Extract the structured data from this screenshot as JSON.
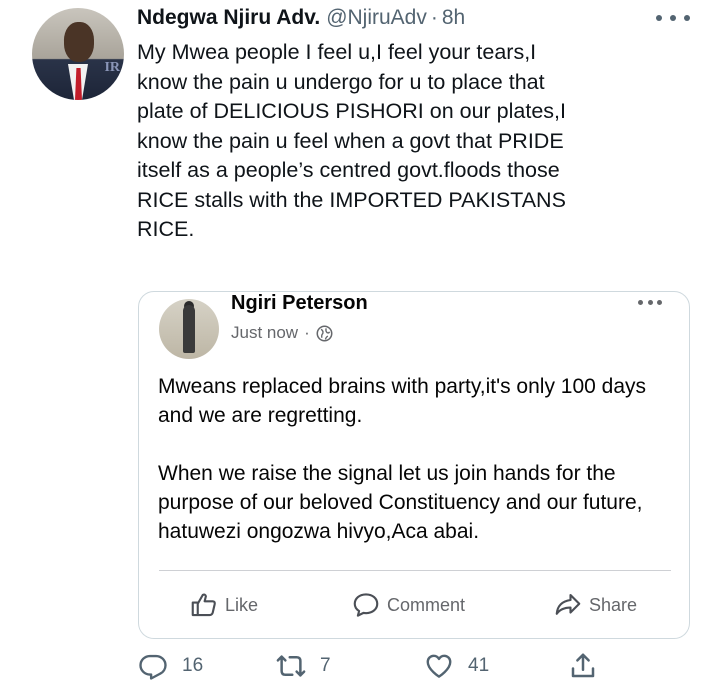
{
  "tweet": {
    "display_name": "Ndegwa Njiru Adv.",
    "handle": "@NjiruAdv",
    "separator": "·",
    "time": "8h",
    "avatar_icon": "user-avatar-suit",
    "more_icon": "more-horizontal-icon",
    "text": "My Mwea people I feel u,I feel your tears,I\nknow the pain u undergo for u to place that\nplate of DELICIOUS PISHORI on our plates,I\nknow the pain u feel when a govt that PRIDE\nitself as a people’s centred govt.floods those\nRICE stalls with the IMPORTED PAKISTANS\nRICE."
  },
  "quoted_post": {
    "author": "Ngiri Peterson",
    "time": "Just now",
    "separator": "·",
    "privacy_icon": "globe-icon",
    "paragraphs": [
      "Mweans replaced brains with party,it's only 100 days and we are regretting.",
      "When we raise the signal let us join hands for the purpose of our beloved Constituency and our future, hatuwezi ongozwa hivyo,Aca abai."
    ],
    "actions": {
      "like": "Like",
      "comment": "Comment",
      "share": "Share"
    }
  },
  "engagement": {
    "replies": "16",
    "retweets": "7",
    "likes": "41"
  },
  "colors": {
    "text_primary": "#0f1419",
    "text_secondary": "#536471",
    "fb_secondary": "#65676b",
    "card_border": "#cfd9de"
  }
}
